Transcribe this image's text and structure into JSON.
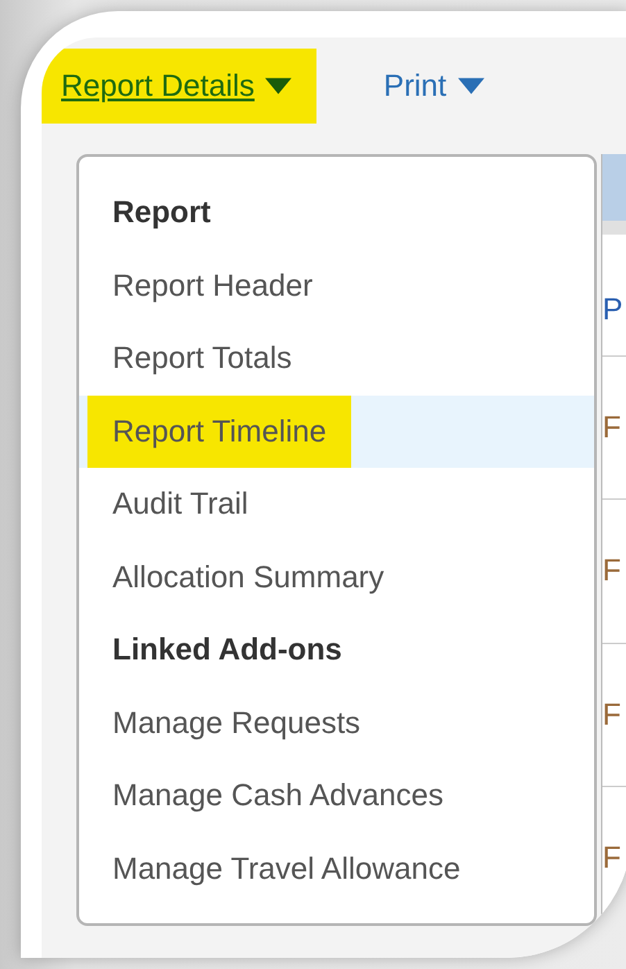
{
  "toolbar": [
    {
      "label": "Report Details",
      "open": true,
      "highlighted": true
    },
    {
      "label": "Print",
      "open": false,
      "highlighted": false
    }
  ],
  "menu": {
    "items": [
      {
        "kind": "heading",
        "label": "Report",
        "selected": false,
        "highlighted": false
      },
      {
        "kind": "item",
        "label": "Report Header",
        "selected": false,
        "highlighted": false
      },
      {
        "kind": "item",
        "label": "Report Totals",
        "selected": false,
        "highlighted": false
      },
      {
        "kind": "item",
        "label": "Report Timeline",
        "selected": true,
        "highlighted": true
      },
      {
        "kind": "item",
        "label": "Audit Trail",
        "selected": false,
        "highlighted": false
      },
      {
        "kind": "item",
        "label": "Allocation Summary",
        "selected": false,
        "highlighted": false
      },
      {
        "kind": "heading",
        "label": "Linked Add-ons",
        "selected": false,
        "highlighted": false
      },
      {
        "kind": "item",
        "label": "Manage Requests",
        "selected": false,
        "highlighted": false
      },
      {
        "kind": "item",
        "label": "Manage Cash Advances",
        "selected": false,
        "highlighted": false
      },
      {
        "kind": "item",
        "label": "Manage Travel Allowance",
        "selected": false,
        "highlighted": false
      }
    ]
  },
  "table": {
    "column_1": {
      "heading": "P",
      "cells": [
        "F",
        "F",
        "F",
        "F"
      ]
    }
  }
}
